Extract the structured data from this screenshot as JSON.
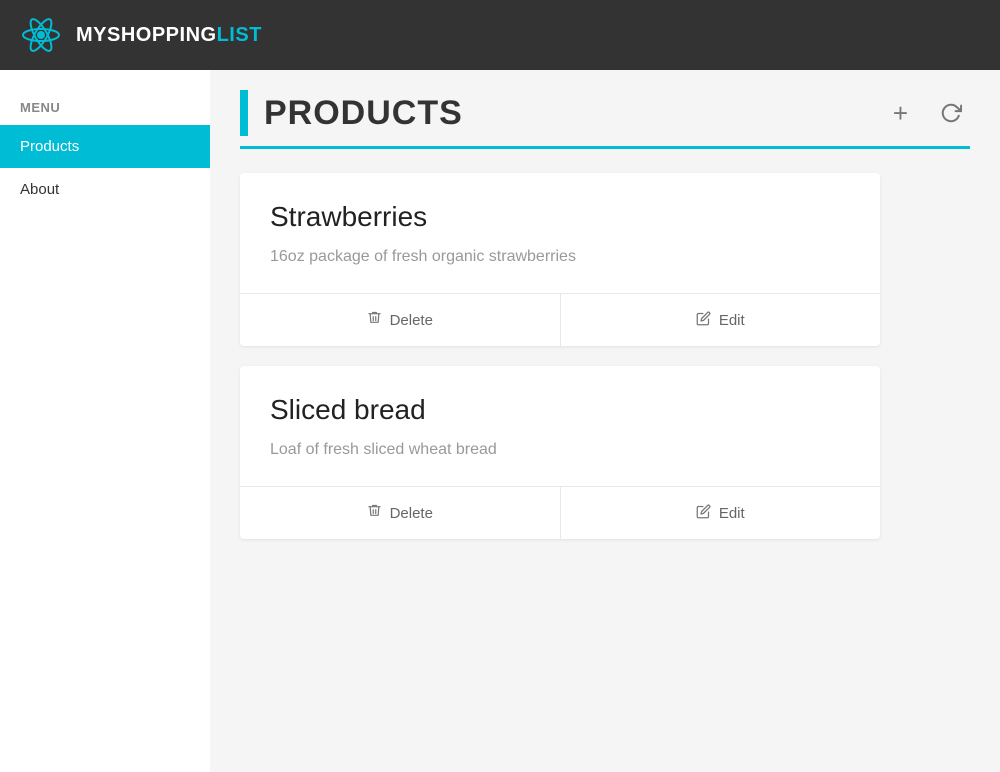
{
  "header": {
    "title_my": "MY",
    "title_shopping": "SHOPPING",
    "title_list": "LIST"
  },
  "sidebar": {
    "menu_label": "MENU",
    "items": [
      {
        "id": "products",
        "label": "Products",
        "active": true
      },
      {
        "id": "about",
        "label": "About",
        "active": false
      }
    ]
  },
  "main": {
    "page_title": "PRODUCTS",
    "add_btn_label": "+",
    "refresh_btn_label": "↺",
    "products": [
      {
        "id": 1,
        "name": "Strawberries",
        "description": "16oz package of fresh organic strawberries",
        "delete_label": "Delete",
        "edit_label": "Edit"
      },
      {
        "id": 2,
        "name": "Sliced bread",
        "description": "Loaf of fresh sliced wheat bread",
        "delete_label": "Delete",
        "edit_label": "Edit"
      }
    ]
  },
  "colors": {
    "accent": "#00bcd4",
    "nav_bg": "#333333",
    "active_nav": "#00bcd4"
  }
}
